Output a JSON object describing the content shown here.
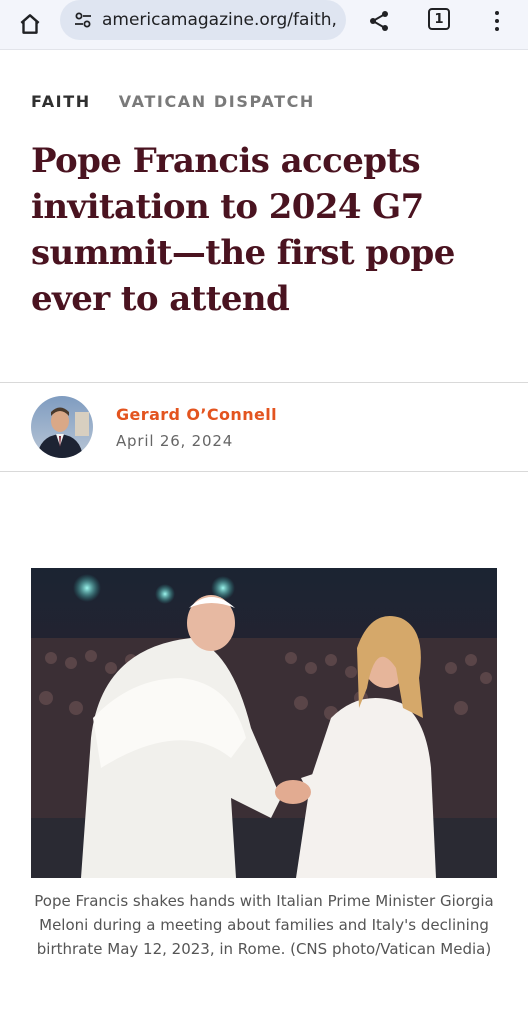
{
  "browser": {
    "url": "americamagazine.org/faith,",
    "tab_count": "1"
  },
  "article": {
    "section": "FAITH",
    "subsection": "VATICAN DISPATCH",
    "headline": "Pope Francis accepts invitation to 2024 G7 summit—the first pope ever to attend",
    "author": "Gerard O’Connell",
    "date": "April 26, 2024",
    "caption": "Pope Francis shakes hands with Italian Prime Minister Giorgia Meloni during a meeting about families and Italy's declining birthrate May 12, 2023, in Rome. (CNS photo/Vatican Media)"
  },
  "colors": {
    "headline": "#4a1320",
    "author": "#e3541f",
    "toolbar_bg": "#f3f5fb",
    "urlbar_bg": "#dfe5f1"
  },
  "icons": [
    "home-icon",
    "tune-icon",
    "share-icon",
    "tab-switcher-icon",
    "more-vert-icon"
  ]
}
